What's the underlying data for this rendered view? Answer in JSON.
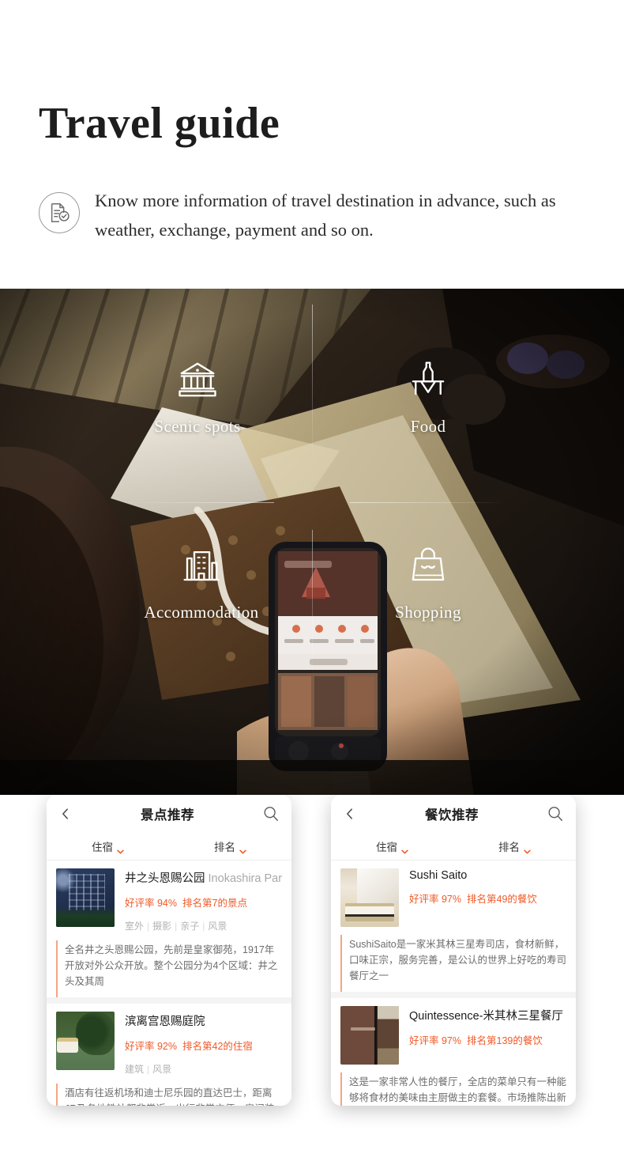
{
  "header": {
    "title": "Travel guide",
    "subtitle": "Know more information of travel destination in advance, such as weather, exchange, payment and so on.",
    "icon": "document-check-icon"
  },
  "hero": {
    "categories": [
      {
        "label": "Scenic spots",
        "icon": "museum-building-icon"
      },
      {
        "label": "Food",
        "icon": "bottle-table-icon"
      },
      {
        "label": "Accommodation",
        "icon": "hotel-building-icon"
      },
      {
        "label": "Shopping",
        "icon": "shopping-bag-icon"
      }
    ]
  },
  "cards": [
    {
      "title": "景点推荐",
      "back_icon": "back-chevron-icon",
      "search_icon": "search-icon",
      "filters": [
        {
          "label": "住宿",
          "icon": "chevron-down-icon"
        },
        {
          "label": "排名",
          "icon": "chevron-down-icon"
        }
      ],
      "items": [
        {
          "name_cn": "井之头恩赐公园",
          "name_en": "Inokashira Park",
          "rating": "好评率 94%",
          "rank": "排名第7的景点",
          "tags": [
            "室外",
            "摄影",
            "亲子",
            "风景"
          ],
          "desc": "全名井之头恩赐公园，先前是皇家御苑，1917年开放对外公众开放。整个公园分为4个区域：井之头及其周",
          "thumb": "hotel-night-photo"
        },
        {
          "name_cn": "滨离宫恩赐庭院",
          "name_en": "",
          "rating": "好评率 92%",
          "rank": "排名第42的住宿",
          "tags": [
            "建筑",
            "风景"
          ],
          "desc": "酒店有往返机场和迪士尼乐园的直达巴士，距离JR及各地铁站都非常近，出行非常方便；房间装潢优雅而…",
          "thumb": "japanese-garden-photo"
        }
      ]
    },
    {
      "title": "餐饮推荐",
      "back_icon": "back-chevron-icon",
      "search_icon": "search-icon",
      "filters": [
        {
          "label": "住宿",
          "icon": "chevron-down-icon"
        },
        {
          "label": "排名",
          "icon": "chevron-down-icon"
        }
      ],
      "items": [
        {
          "name_cn": "Sushi Saito",
          "name_en": "",
          "rating": "好评率 97%",
          "rank": "排名第49的餐饮",
          "tags": [],
          "desc": "SushiSaito是一家米其林三星寿司店，食材新鲜，口味正宗，服务完善，是公认的世界上好吃的寿司餐厅之一",
          "thumb": "sushi-chef-photo"
        },
        {
          "name_cn": "Quintessence-米其林三星餐厅",
          "name_en": "",
          "rating": "好评率 97%",
          "rank": "排名第139的餐饮",
          "tags": [],
          "desc": "这是一家非常人性的餐厅，全店的菜单只有一种能够将食材的美味由主厨做主的套餐。市场推陈出新的菜品也",
          "thumb": "restaurant-door-photo"
        }
      ]
    }
  ],
  "colors": {
    "accent_orange": "#f05a28",
    "title_black": "#1d1d1d",
    "tag_gray": "#b3b3b3",
    "desc_gray": "#6d6d6d",
    "card_bg": "#ffffff",
    "body_bg": "#f4f4f4"
  }
}
